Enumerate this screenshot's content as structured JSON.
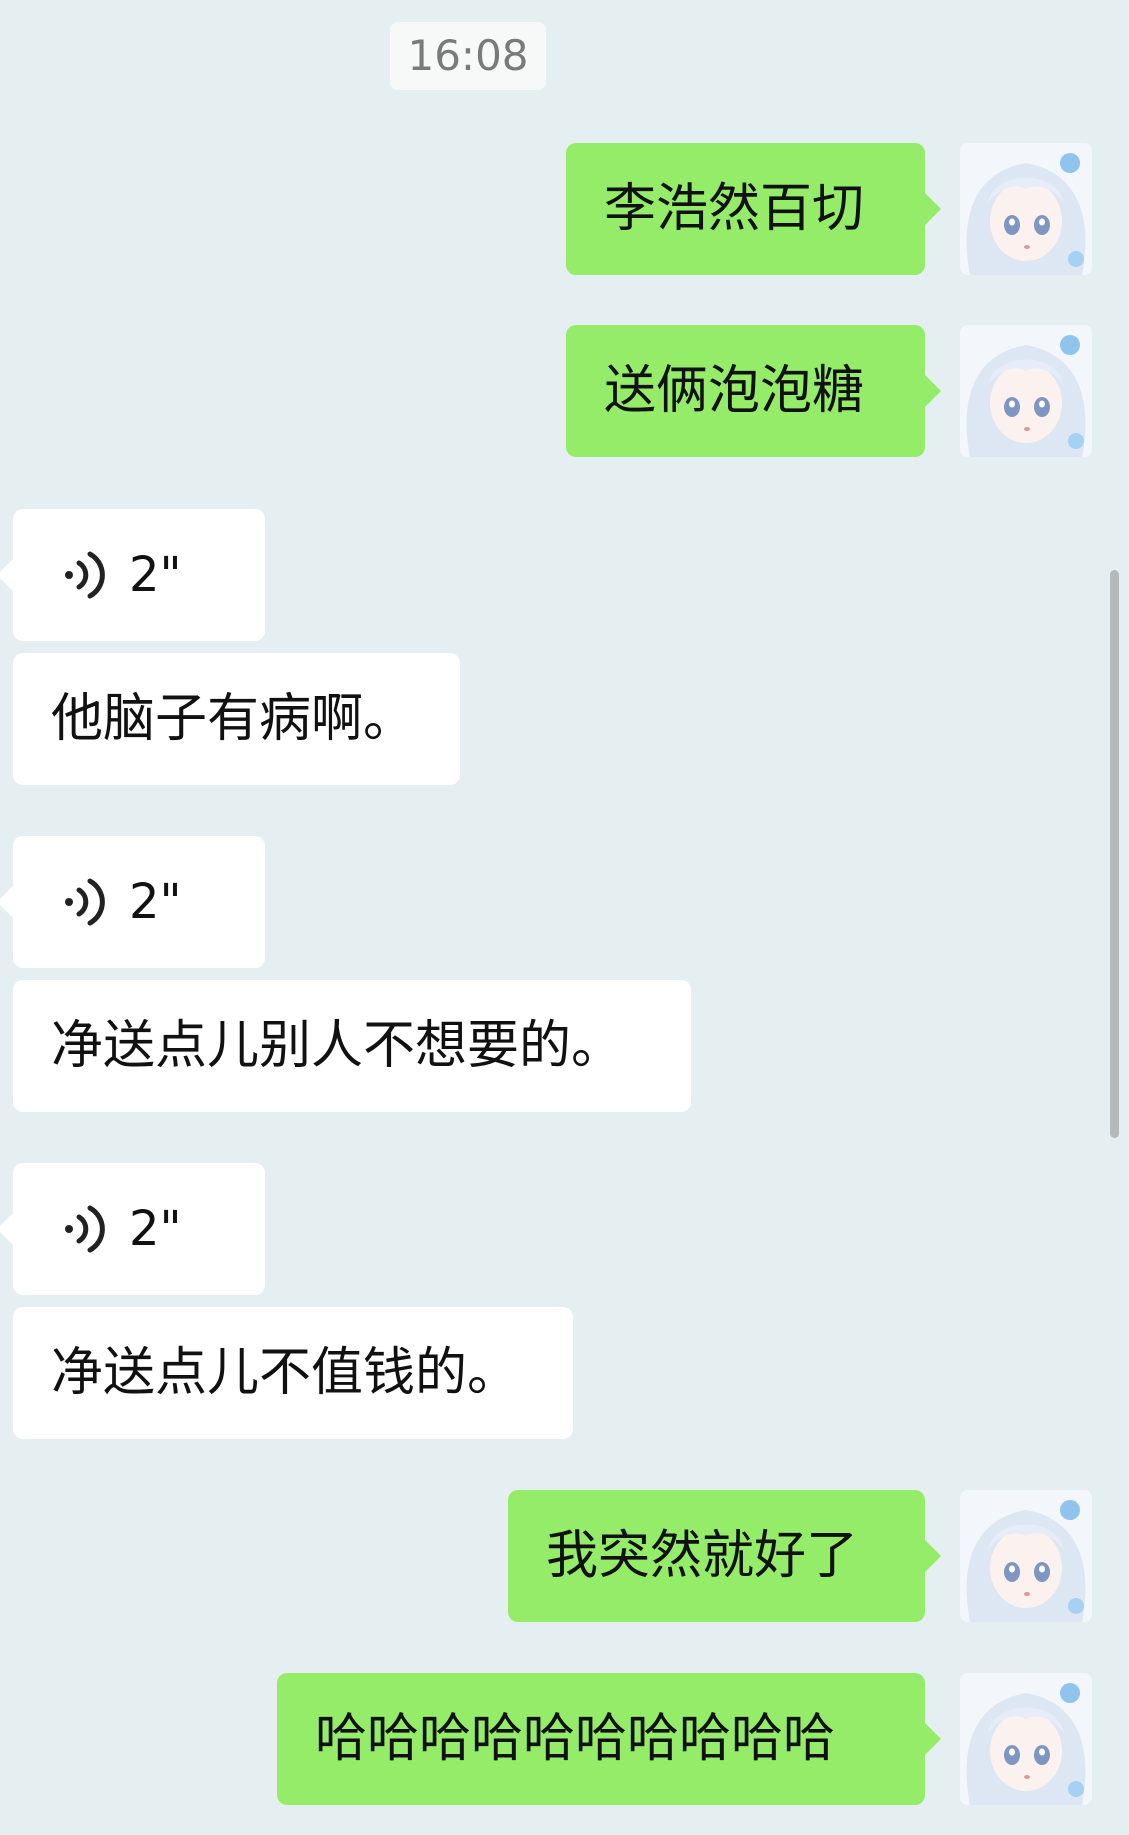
{
  "timestamp": "16:08",
  "messages": [
    {
      "type": "text",
      "direction": "out",
      "text": "李浩然百切"
    },
    {
      "type": "text",
      "direction": "out",
      "text": "送俩泡泡糖"
    },
    {
      "type": "voice",
      "direction": "in",
      "duration": "2\"",
      "icon": "voice-wave-icon"
    },
    {
      "type": "text",
      "direction": "in",
      "text": "他脑子有病啊。"
    },
    {
      "type": "voice",
      "direction": "in",
      "duration": "2\"",
      "icon": "voice-wave-icon"
    },
    {
      "type": "text",
      "direction": "in",
      "text": "净送点儿别人不想要的。"
    },
    {
      "type": "voice",
      "direction": "in",
      "duration": "2\"",
      "icon": "voice-wave-icon"
    },
    {
      "type": "text",
      "direction": "in",
      "text": "净送点儿不值钱的。"
    },
    {
      "type": "text",
      "direction": "out",
      "text": "我突然就好了"
    },
    {
      "type": "text",
      "direction": "out",
      "text": "哈哈哈哈哈哈哈哈哈哈"
    }
  ],
  "colors": {
    "background": "#e5eff1",
    "outgoing_bubble": "#95ec69",
    "incoming_bubble": "#ffffff",
    "timestamp_text": "#7a7a7a"
  }
}
